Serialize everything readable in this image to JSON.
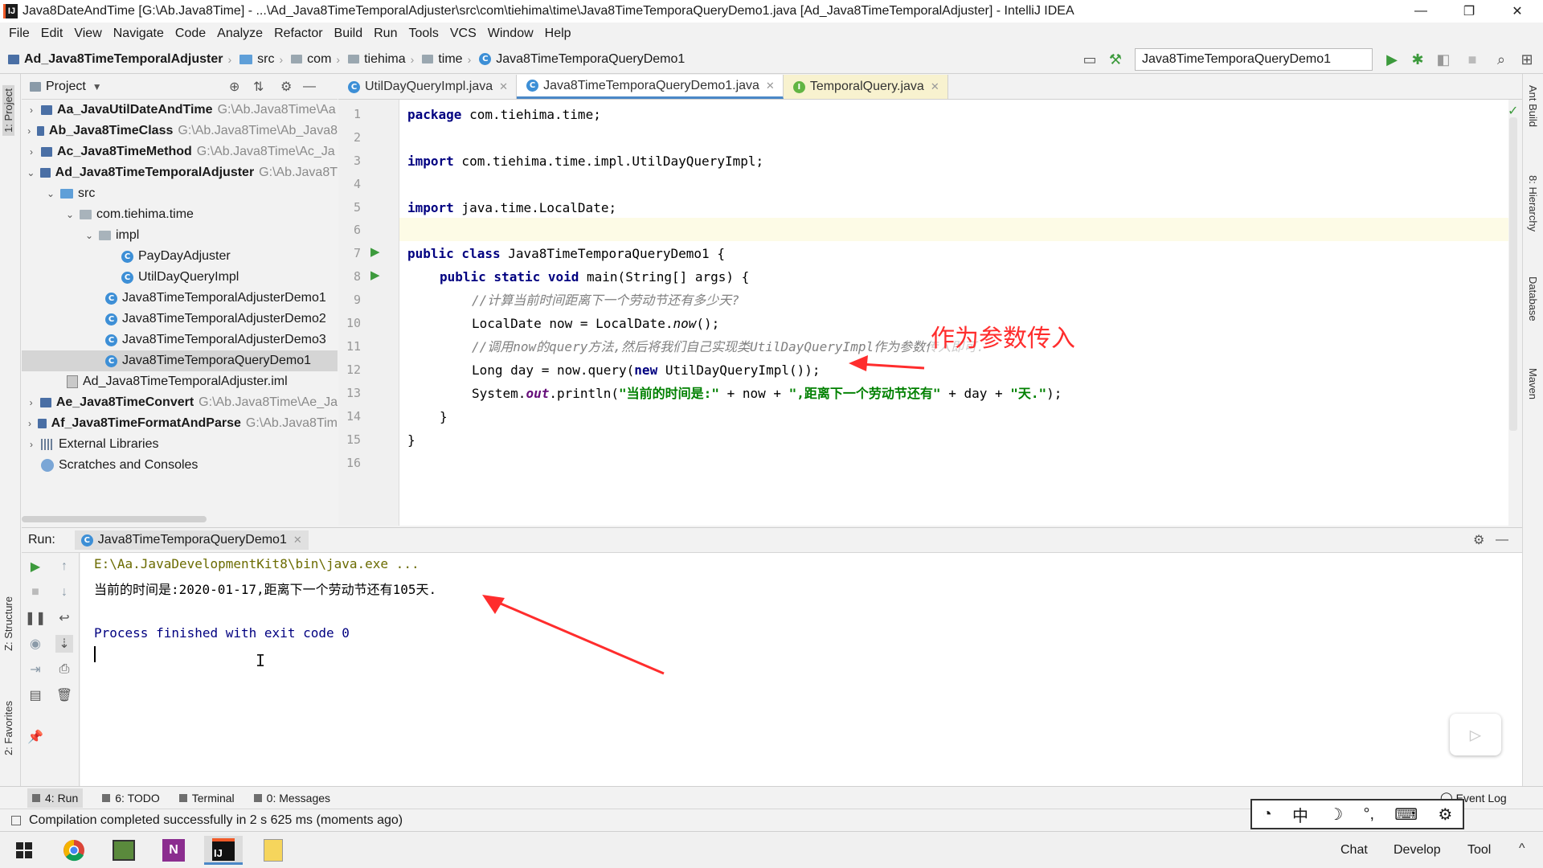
{
  "window": {
    "title": "Java8DateAndTime [G:\\Ab.Java8Time] - ...\\Ad_Java8TimeTemporalAdjuster\\src\\com\\tiehima\\time\\Java8TimeTemporaQueryDemo1.java [Ad_Java8TimeTemporalAdjuster] - IntelliJ IDEA",
    "minimize": "—",
    "restore": "❐",
    "close": "✕"
  },
  "menu": [
    "File",
    "Edit",
    "View",
    "Navigate",
    "Code",
    "Analyze",
    "Refactor",
    "Build",
    "Run",
    "Tools",
    "VCS",
    "Window",
    "Help"
  ],
  "breadcrumb": [
    "Ad_Java8TimeTemporalAdjuster",
    "src",
    "com",
    "tiehima",
    "time",
    "Java8TimeTemporaQueryDemo1"
  ],
  "run_config": "Java8TimeTemporaQueryDemo1",
  "left_stripe": {
    "project": "1: Project",
    "structure": "Z: Structure",
    "favorites": "2: Favorites"
  },
  "right_stripe": {
    "ant": "Ant Build",
    "hierarchy": "8: Hierarchy",
    "database": "Database",
    "maven": "Maven"
  },
  "project_panel": {
    "title": "Project",
    "tree": [
      {
        "label": "Aa_JavaUtilDateAndTime",
        "path": "G:\\Ab.Java8Time\\Aa",
        "bold": true,
        "arrow": "›"
      },
      {
        "label": "Ab_Java8TimeClass",
        "path": "G:\\Ab.Java8Time\\Ab_Java8",
        "bold": true,
        "arrow": "›"
      },
      {
        "label": "Ac_Java8TimeMethod",
        "path": "G:\\Ab.Java8Time\\Ac_Ja",
        "bold": true,
        "arrow": "›"
      },
      {
        "label": "Ad_Java8TimeTemporalAdjuster",
        "path": "G:\\Ab.Java8T",
        "bold": true,
        "arrow": "⌄"
      },
      {
        "label": "src",
        "path": "",
        "bold": false,
        "arrow": "⌄"
      },
      {
        "label": "com.tiehima.time",
        "path": "",
        "bold": false,
        "arrow": "⌄"
      },
      {
        "label": "impl",
        "path": "",
        "bold": false,
        "arrow": "⌄"
      },
      {
        "label": "PayDayAdjuster",
        "path": "",
        "bold": false,
        "arrow": ""
      },
      {
        "label": "UtilDayQueryImpl",
        "path": "",
        "bold": false,
        "arrow": ""
      },
      {
        "label": "Java8TimeTemporalAdjusterDemo1",
        "path": "",
        "bold": false,
        "arrow": ""
      },
      {
        "label": "Java8TimeTemporalAdjusterDemo2",
        "path": "",
        "bold": false,
        "arrow": ""
      },
      {
        "label": "Java8TimeTemporalAdjusterDemo3",
        "path": "",
        "bold": false,
        "arrow": ""
      },
      {
        "label": "Java8TimeTemporaQueryDemo1",
        "path": "",
        "bold": false,
        "arrow": ""
      },
      {
        "label": "Ad_Java8TimeTemporalAdjuster.iml",
        "path": "",
        "bold": false,
        "arrow": ""
      },
      {
        "label": "Ae_Java8TimeConvert",
        "path": "G:\\Ab.Java8Time\\Ae_Ja",
        "bold": true,
        "arrow": "›"
      },
      {
        "label": "Af_Java8TimeFormatAndParse",
        "path": "G:\\Ab.Java8Tim",
        "bold": true,
        "arrow": "›"
      },
      {
        "label": "External Libraries",
        "path": "",
        "bold": false,
        "arrow": "›"
      },
      {
        "label": "Scratches and Consoles",
        "path": "",
        "bold": false,
        "arrow": ""
      }
    ]
  },
  "tabs": [
    {
      "label": "UtilDayQueryImpl.java",
      "icon": "C"
    },
    {
      "label": "Java8TimeTemporaQueryDemo1.java",
      "icon": "C"
    },
    {
      "label": "TemporalQuery.java",
      "icon": "I"
    }
  ],
  "editor": {
    "line_numbers": [
      "1",
      "2",
      "3",
      "4",
      "5",
      "6",
      "7",
      "8",
      "9",
      "10",
      "11",
      "12",
      "13",
      "14",
      "15",
      "16"
    ],
    "lines": {
      "l1_kw": "package",
      "l1": " com.tiehima.time;",
      "l3_kw": "import",
      "l3": " com.tiehima.time.impl.UtilDayQueryImpl;",
      "l5_kw": "import",
      "l5": " java.time.LocalDate;",
      "l7_kw": "public class",
      "l7": " Java8TimeTemporaQueryDemo1 {",
      "l8_kw": "public static void",
      "l8": " main(String[] args) {",
      "l9": "//计算当前时间距离下一个劳动节还有多少天?",
      "l10_a": "LocalDate now = LocalDate.",
      "l10_b": "now",
      "l10_c": "();",
      "l11": "//调用now的query方法,然后将我们自己实现类UtilDayQueryImpl作为参数传入即可.",
      "l12_a": "Long day = now.query(",
      "l12_kw": "new",
      "l12_b": " UtilDayQueryImpl());",
      "l13_a": "System.",
      "l13_out": "out",
      "l13_b": ".println(",
      "l13_s1": "\"当前的时间是:\"",
      "l13_c": " + now + ",
      "l13_s2": "\",距离下一个劳动节还有\"",
      "l13_d": " + day + ",
      "l13_s3": "\"天.\"",
      "l13_e": ");",
      "l14": "}",
      "l15": "}"
    }
  },
  "annotation": "作为参数传入",
  "run_panel": {
    "label": "Run:",
    "tab": "Java8TimeTemporaQueryDemo1",
    "console": [
      "E:\\Aa.JavaDevelopmentKit8\\bin\\java.exe ...",
      "当前的时间是:2020-01-17,距离下一个劳动节还有105天.",
      "Process finished with exit code 0"
    ]
  },
  "bottom_tabs": [
    "4: Run",
    "6: TODO",
    "Terminal",
    "0: Messages"
  ],
  "event_log": "Event Log",
  "status": "Compilation completed successfully in 2 s 625 ms (moments ago)",
  "ime": [
    "中",
    "☽",
    "°,",
    "⌨",
    "⚙"
  ],
  "taskbar": {
    "chat": "Chat",
    "develop": "Develop",
    "tool": "Tool"
  },
  "colors": {
    "keyword": "#000080",
    "string": "#008000",
    "comment": "#808080",
    "annotation": "#ff2d2d",
    "console_text": "#000080"
  }
}
